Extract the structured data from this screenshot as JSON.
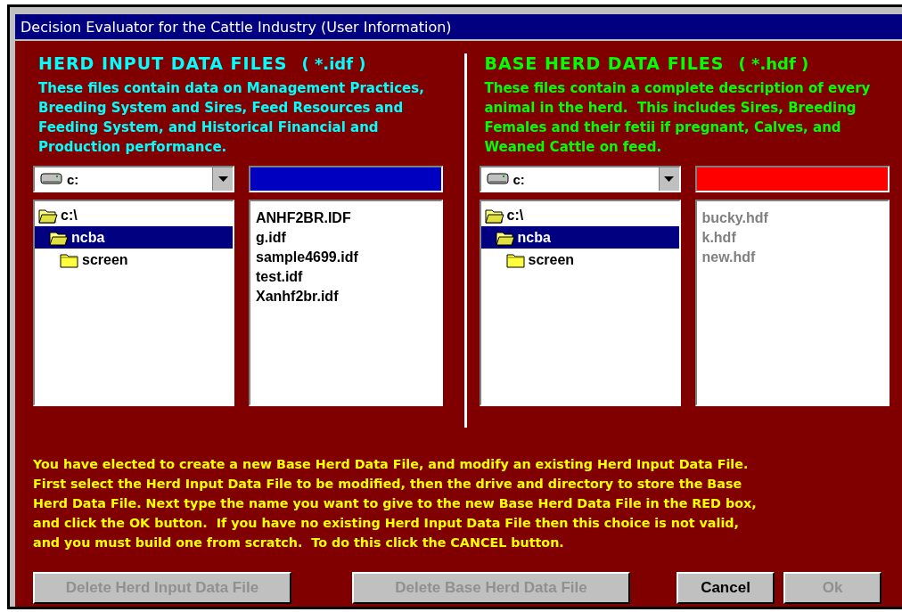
{
  "window": {
    "title": "Decision Evaluator for the Cattle Industry (User Information)"
  },
  "panels": [
    {
      "heading": "HERD INPUT DATA FILES",
      "pattern": "( *.idf )",
      "color": "#00ffff",
      "description": "These files contain data on Management Practices, Breeding System and Sires, Feed Resources and Feeding System, and Historical Financial and Production performance.",
      "drive": "c:",
      "name_field": {
        "color": "#0000c0"
      },
      "tree": [
        {
          "label": "c:\\",
          "selected": false,
          "expanded": true,
          "children": [
            {
              "label": "ncba",
              "selected": true,
              "expanded": true,
              "children": [
                {
                  "label": "screen",
                  "selected": false,
                  "expanded": false
                }
              ]
            }
          ]
        }
      ],
      "files": [
        {
          "label": "ANHF2BR.IDF",
          "disabled": false
        },
        {
          "label": "g.idf",
          "disabled": false
        },
        {
          "label": "sample4699.idf",
          "disabled": false
        },
        {
          "label": "test.idf",
          "disabled": false
        },
        {
          "label": "Xanhf2br.idf",
          "disabled": false
        }
      ]
    },
    {
      "heading": "BASE HERD DATA FILES",
      "pattern": "( *.hdf )",
      "color": "#00ff00",
      "description": "These files contain a complete description of every animal in the herd.  This includes Sires, Breeding Females and their fetii if pregnant, Calves, and Weaned Cattle on feed.",
      "drive": "c:",
      "name_field": {
        "color": "#ff0000"
      },
      "tree": [
        {
          "label": "c:\\",
          "selected": false,
          "expanded": true,
          "children": [
            {
              "label": "ncba",
              "selected": true,
              "expanded": true,
              "children": [
                {
                  "label": "screen",
                  "selected": false,
                  "expanded": false
                }
              ]
            }
          ]
        }
      ],
      "files": [
        {
          "label": "bucky.hdf",
          "disabled": true
        },
        {
          "label": "k.hdf",
          "disabled": true
        },
        {
          "label": "new.hdf",
          "disabled": true
        }
      ]
    }
  ],
  "instructions": [
    "You have elected to create a new Base Herd Data File, and modify an existing Herd Input Data File.",
    "First select the Herd Input Data File to be modified, then the drive and directory to store the Base",
    "Herd Data File. Next type the name you want to give to the new Base Herd Data File in the RED box,",
    "and click the OK button.  If you have no existing Herd Input Data File then this choice is not valid,",
    "and you must build one from scratch.  To do this click the CANCEL button."
  ],
  "buttons": [
    {
      "label": "Delete Herd Input Data File",
      "disabled": true
    },
    {
      "label": "Delete Base Herd Data File",
      "disabled": true
    },
    {
      "label": "Cancel",
      "disabled": false
    },
    {
      "label": "Ok",
      "disabled": true
    }
  ]
}
